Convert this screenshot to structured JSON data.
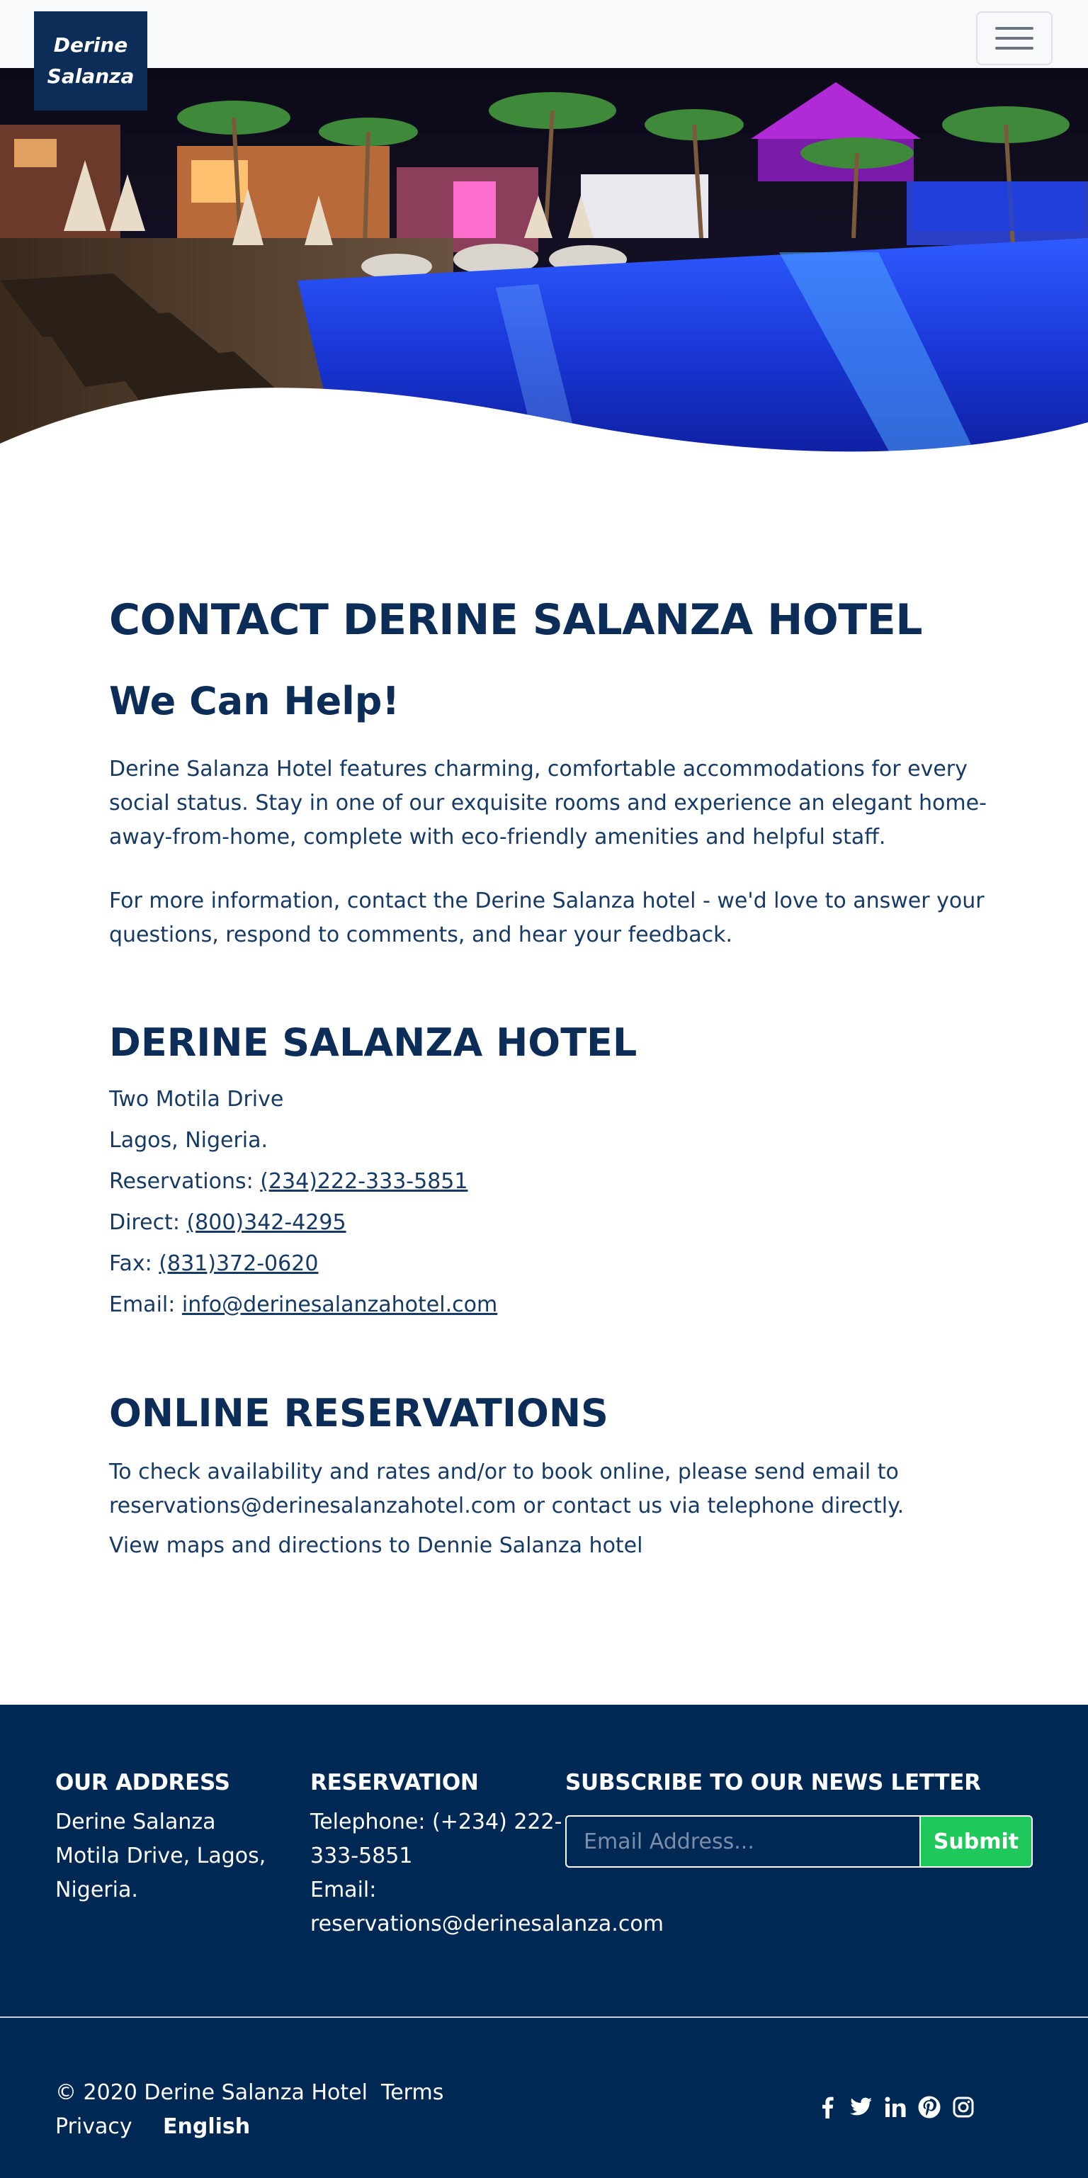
{
  "navbar": {
    "brand_line1": "Derine",
    "brand_line2": "Salanza"
  },
  "main": {
    "title": "CONTACT DERINE SALANZA HOTEL",
    "subtitle": "We Can Help!",
    "intro": "Derine Salanza Hotel features charming, comfortable accommodations for every social status. Stay in one of our exquisite rooms and experience an elegant home-away-from-home, complete with eco-friendly amenities and helpful staff.",
    "info": "For more information, contact the Derine Salanza hotel - we'd love to answer your questions, respond to comments, and hear your feedback."
  },
  "hotel": {
    "heading": "DERINE SALANZA HOTEL",
    "address1": "Two Motila Drive",
    "address2": "Lagos, Nigeria.",
    "reservations_label": "Reservations: ",
    "reservations_phone": "(234)222-333-5851",
    "direct_label": "Direct: ",
    "direct_phone": "(800)342-4295",
    "fax_label": "Fax: ",
    "fax_phone": "(831)372-0620",
    "email_label": "Email: ",
    "email": "info@derinesalanzahotel.com"
  },
  "online": {
    "heading": "ONLINE RESERVATIONS",
    "text": "To check availability and rates and/or to book online, please send email to reservations@derinesalanzahotel.com or contact us via telephone directly.",
    "maps": "View maps and directions to Dennie Salanza hotel"
  },
  "footer": {
    "address_heading": "OUR ADDRESS",
    "address_text": "Derine Salanza Motila Drive, Lagos, Nigeria.",
    "reservation_heading": "RESERVATION",
    "reservation_phone": "Telephone: (+234) 222-333-5851",
    "reservation_email_label": "Email:",
    "reservation_email": "reservations@derinesalanza.com",
    "newsletter_heading": "SUBSCRIBE TO OUR NEWS LETTER",
    "email_placeholder": "Email Address...",
    "submit_label": "Submit",
    "copyright": "© 2020 Derine Salanza Hotel",
    "terms": "Terms",
    "privacy": "Privacy",
    "language": "English",
    "socials": [
      "facebook-icon",
      "twitter-icon",
      "linkedin-icon",
      "pinterest-icon",
      "instagram-icon"
    ]
  },
  "colors": {
    "navy": "#0b2d57",
    "footer_bg": "#002855",
    "submit_green": "#1ec85a"
  }
}
